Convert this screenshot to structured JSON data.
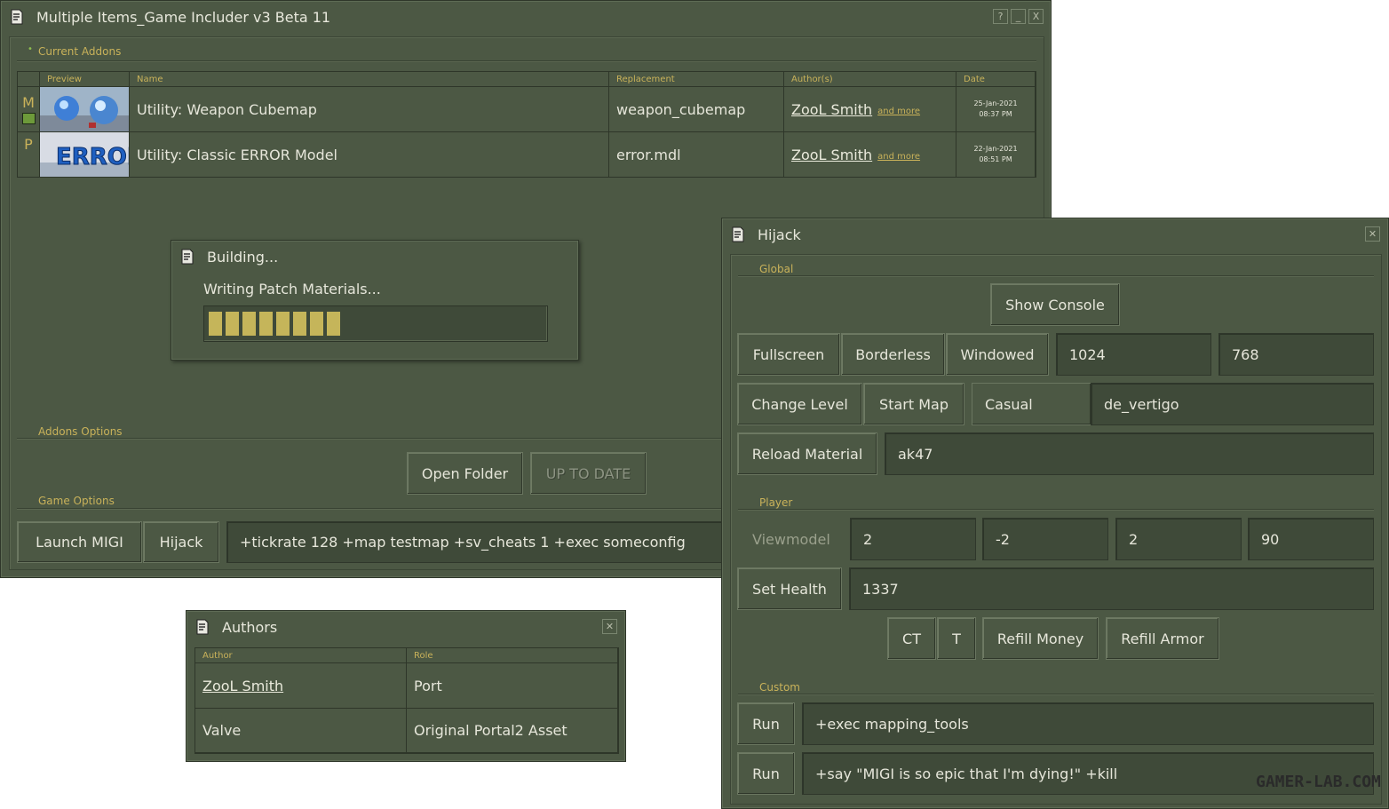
{
  "main": {
    "title": "Multiple Items_Game Includer v3 Beta 11",
    "buttons": {
      "help": "?",
      "minimize": "_",
      "close": "X"
    },
    "current_addons_label": "Current Addons",
    "table": {
      "headers": [
        "Preview",
        "Name",
        "Replacement",
        "Author(s)",
        "Date"
      ],
      "rows": [
        {
          "flag": "M",
          "name": "Utility: Weapon Cubemap",
          "replacement": "weapon_cubemap",
          "author": "ZooL Smith",
          "more": "and more",
          "date": "25-Jan-2021",
          "time": "08:37 PM"
        },
        {
          "flag": "P",
          "name": "Utility: Classic ERROR Model",
          "replacement": "error.mdl",
          "author": "ZooL Smith",
          "more": "and more",
          "date": "22-Jan-2021",
          "time": "08:51 PM"
        }
      ]
    },
    "addons_options_label": "Addons Options",
    "open_folder": "Open Folder",
    "up_to_date": "UP TO DATE",
    "game_options_label": "Game Options",
    "launch": "Launch MIGI",
    "hijack": "Hijack",
    "launch_args": "+tickrate 128 +map testmap +sv_cheats 1 +exec someconfig"
  },
  "building": {
    "title": "Building...",
    "status": "Writing Patch Materials...",
    "progress_segments": 8
  },
  "authors": {
    "title": "Authors",
    "headers": [
      "Author",
      "Role"
    ],
    "rows": [
      {
        "author": "ZooL Smith",
        "role": "Port"
      },
      {
        "author": "Valve",
        "role": "Original Portal2 Asset"
      }
    ]
  },
  "hijack": {
    "title": "Hijack",
    "global_label": "Global",
    "show_console": "Show Console",
    "fullscreen": "Fullscreen",
    "borderless": "Borderless",
    "windowed": "Windowed",
    "width": "1024",
    "height": "768",
    "change_level": "Change Level",
    "start_map": "Start Map",
    "mode": "Casual",
    "map": "de_vertigo",
    "reload_material": "Reload Material",
    "material": "ak47",
    "player_label": "Player",
    "viewmodel_label": "Viewmodel",
    "viewmodel": [
      "2",
      "-2",
      "2",
      "90"
    ],
    "set_health": "Set Health",
    "health": "1337",
    "ct": "CT",
    "t": "T",
    "refill_money": "Refill Money",
    "refill_armor": "Refill Armor",
    "custom_label": "Custom",
    "run": "Run",
    "custom_cmds": [
      "+exec mapping_tools",
      "+say \"MIGI is so epic that I'm dying!\" +kill"
    ]
  },
  "watermark": "GAMER-LAB.COM"
}
